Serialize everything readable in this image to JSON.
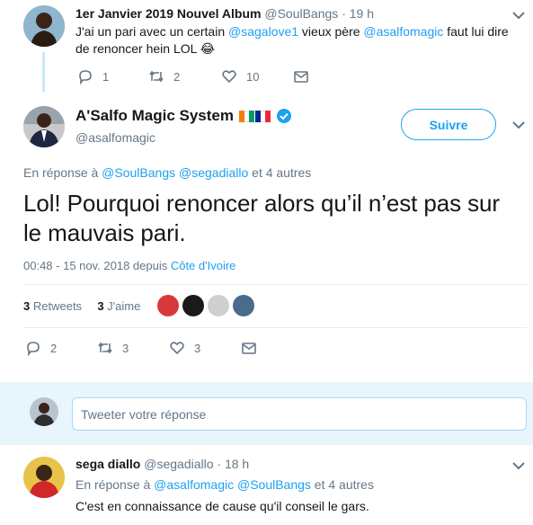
{
  "tweet1": {
    "name": "1er Janvier 2019 Nouvel Album",
    "handle": "@SoulBangs",
    "time": "· 19 h",
    "text_prefix": "J'ai un pari avec un certain ",
    "mention1": "@sagalove1",
    "text_mid": " vieux père ",
    "mention2": "@asalfomagic",
    "text_suffix": "  faut lui dire de renoncer hein LOL 😂",
    "replies": "1",
    "retweets": "2",
    "likes": "10"
  },
  "main": {
    "name": "A'Salfo Magic System",
    "handle": "@asalfomagic",
    "follow_label": "Suivre",
    "reply_prefix": "En réponse à ",
    "reply_mention1": "@SoulBangs",
    "reply_mention2": "@segadiallo",
    "reply_suffix": " et 4 autres",
    "text": "Lol! Pourquoi renoncer alors qu’il n’est pas sur le mauvais pari.",
    "timestamp": "00:48 - 15 nov. 2018 depuis ",
    "location": "Côte d'Ivoire",
    "retweets_count": "3",
    "retweets_label": "Retweets",
    "likes_count": "3",
    "likes_label": "J'aime",
    "replies": "2",
    "retweets": "3",
    "likes": "3"
  },
  "composer": {
    "placeholder": "Tweeter votre réponse"
  },
  "reply": {
    "name": "sega diallo",
    "handle": "@segadiallo",
    "time": "· 18 h",
    "reply_prefix": "En réponse à ",
    "reply_mention1": "@asalfomagic",
    "reply_mention2": "@SoulBangs",
    "reply_suffix": " et 4 autres",
    "text": "C'est en connaissance de cause qu'il conseil le gars."
  },
  "colors": {
    "accent": "#1da1f2",
    "verified": "#1da1f2",
    "muted": "#657786",
    "flag": [
      "#f77f00",
      "#ffffff",
      "#009e60",
      "#002395",
      "#ffffff",
      "#ed2939"
    ]
  },
  "icons": [
    "chevron-down-icon",
    "reply-icon",
    "retweet-icon",
    "like-icon",
    "message-icon",
    "verified-icon"
  ]
}
